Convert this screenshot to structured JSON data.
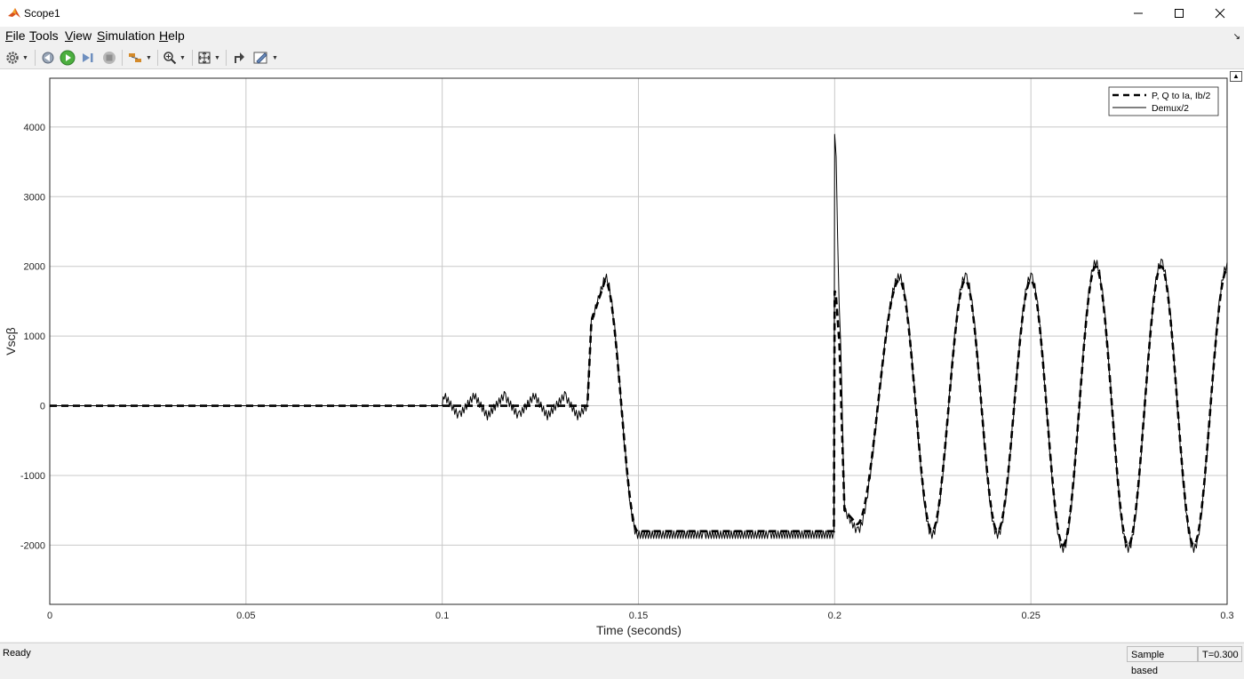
{
  "window": {
    "title": "Scope1"
  },
  "menu": {
    "items": [
      {
        "key": "F",
        "rest": "ile"
      },
      {
        "key": "T",
        "rest": "ools"
      },
      {
        "key": "V",
        "rest": "iew"
      },
      {
        "key": "S",
        "rest": "imulation"
      },
      {
        "key": "H",
        "rest": "elp"
      }
    ]
  },
  "toolbar": {
    "icons": [
      "settings-icon",
      "step-back-icon",
      "run-icon",
      "step-forward-icon",
      "stop-icon",
      "highlight-icon",
      "zoom-icon",
      "fit-to-view-icon",
      "cursor-measure-icon",
      "style-icon"
    ]
  },
  "status": {
    "ready": "Ready",
    "mode": "Sample based",
    "time": "T=0.300"
  },
  "chart_data": {
    "type": "line",
    "xlabel": "Time (seconds)",
    "ylabel": "Vscβ",
    "xlim": [
      0,
      0.3
    ],
    "ylim": [
      -2850,
      4700
    ],
    "xticks": [
      0,
      0.05,
      0.1,
      0.15,
      0.2,
      0.25,
      0.3
    ],
    "xtick_labels": [
      "0",
      "0.05",
      "0.1",
      "0.15",
      "0.2",
      "0.25",
      "0.3"
    ],
    "yticks": [
      -2000,
      -1000,
      0,
      1000,
      2000,
      3000,
      4000
    ],
    "ytick_labels": [
      "-2000",
      "-1000",
      "0",
      "1000",
      "2000",
      "3000",
      "4000"
    ],
    "grid": true,
    "legend_position": "top-right",
    "series": [
      {
        "name": "P, Q to Ia, Ib/2",
        "style": "dashed",
        "color": "#000000",
        "x": [
          0,
          0.1,
          0.137,
          0.138,
          0.1415,
          0.1498,
          0.1665,
          0.1832,
          0.1998,
          0.2,
          0.2003,
          0.2012,
          0.2025,
          0.2057,
          0.2165,
          0.2248,
          0.2333,
          0.2415,
          0.25,
          0.2582,
          0.2665,
          0.2748,
          0.2832,
          0.2915,
          0.3
        ],
        "y": [
          0,
          0,
          0,
          1200,
          1800,
          -1800,
          -1800,
          -1800,
          -1800,
          1650,
          1600,
          900,
          -1500,
          -1700,
          1800,
          -1800,
          1800,
          -1800,
          1800,
          -2000,
          2000,
          -2000,
          2000,
          -2000,
          1950
        ]
      },
      {
        "name": "Demux/2",
        "style": "solid",
        "color": "#000000",
        "x": [
          0,
          0.1,
          0.1005,
          0.1042,
          0.1082,
          0.1115,
          0.1158,
          0.1194,
          0.1235,
          0.1268,
          0.1312,
          0.1345,
          0.137,
          0.138,
          0.1415,
          0.1498,
          0.1665,
          0.1832,
          0.1998,
          0.2,
          0.2015,
          0.2025,
          0.2057,
          0.2165,
          0.2248,
          0.2333,
          0.2415,
          0.25,
          0.2582,
          0.2665,
          0.2748,
          0.2832,
          0.2915,
          0.3
        ],
        "y": [
          0,
          0,
          150,
          -150,
          150,
          -150,
          150,
          -150,
          150,
          -150,
          150,
          -150,
          0,
          1200,
          1850,
          -1850,
          -1850,
          -1850,
          -1850,
          3950,
          1000,
          -1500,
          -1800,
          1850,
          -1850,
          1850,
          -1850,
          1850,
          -2050,
          2050,
          -2050,
          2050,
          -2050,
          2000
        ]
      }
    ]
  }
}
